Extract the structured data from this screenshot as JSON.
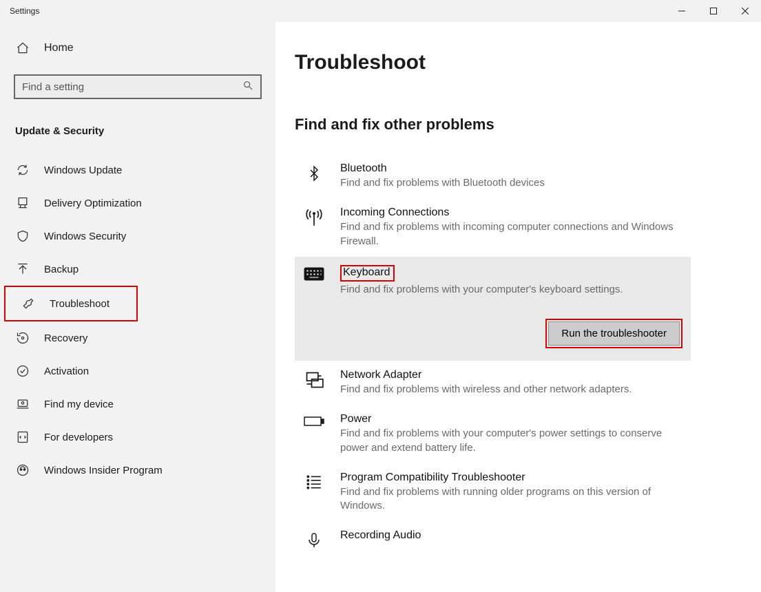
{
  "window": {
    "title": "Settings"
  },
  "sidebar": {
    "home": "Home",
    "search_placeholder": "Find a setting",
    "group": "Update & Security",
    "items": [
      {
        "label": "Windows Update"
      },
      {
        "label": "Delivery Optimization"
      },
      {
        "label": "Windows Security"
      },
      {
        "label": "Backup"
      },
      {
        "label": "Troubleshoot"
      },
      {
        "label": "Recovery"
      },
      {
        "label": "Activation"
      },
      {
        "label": "Find my device"
      },
      {
        "label": "For developers"
      },
      {
        "label": "Windows Insider Program"
      }
    ]
  },
  "main": {
    "title": "Troubleshoot",
    "section": "Find and fix other problems",
    "items": [
      {
        "title": "Bluetooth",
        "desc": "Find and fix problems with Bluetooth devices"
      },
      {
        "title": "Incoming Connections",
        "desc": "Find and fix problems with incoming computer connections and Windows Firewall."
      },
      {
        "title": "Keyboard",
        "desc": "Find and fix problems with your computer's keyboard settings."
      },
      {
        "title": "Network Adapter",
        "desc": "Find and fix problems with wireless and other network adapters."
      },
      {
        "title": "Power",
        "desc": "Find and fix problems with your computer's power settings to conserve power and extend battery life."
      },
      {
        "title": "Program Compatibility Troubleshooter",
        "desc": "Find and fix problems with running older programs on this version of Windows."
      },
      {
        "title": "Recording Audio",
        "desc": ""
      }
    ],
    "run_label": "Run the troubleshooter"
  }
}
